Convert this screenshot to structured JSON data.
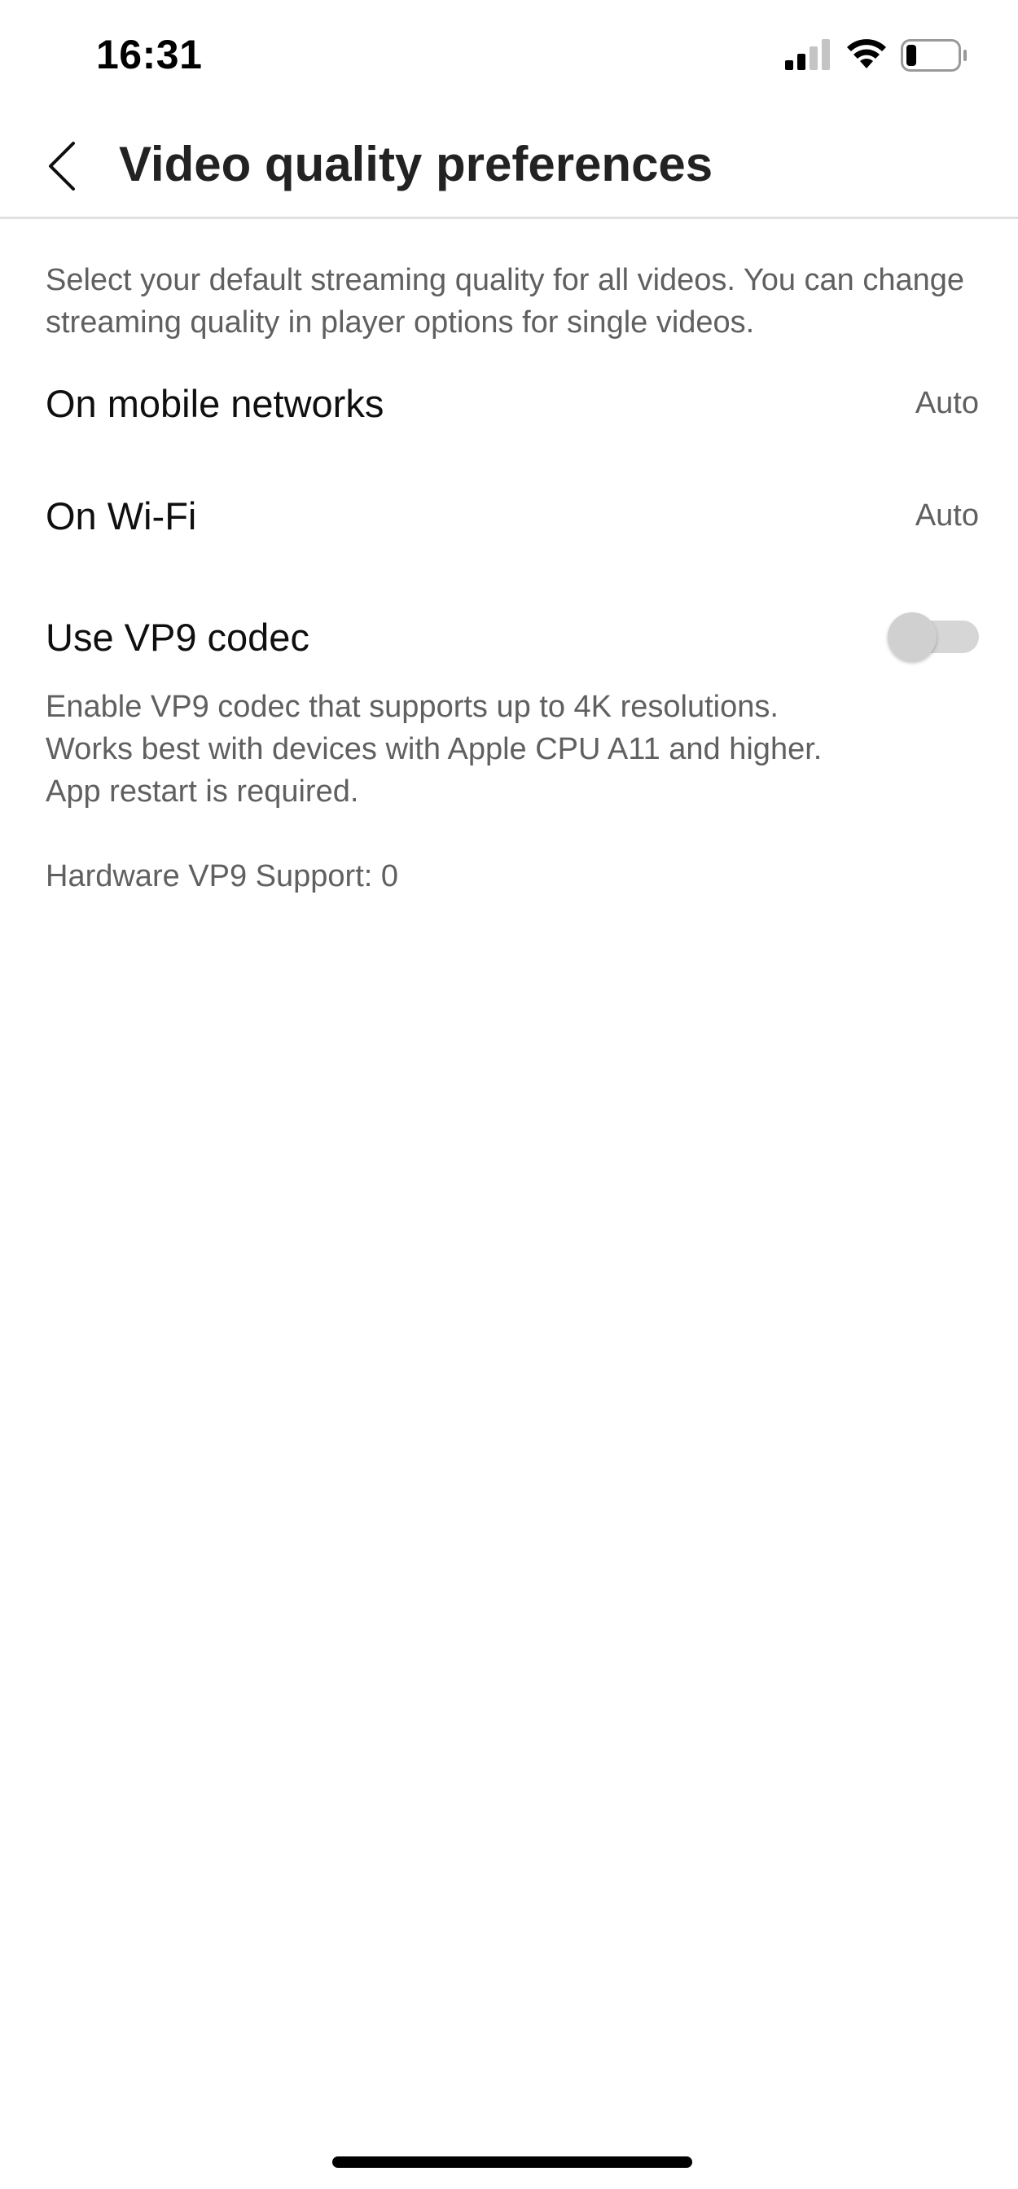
{
  "status_bar": {
    "time": "16:31",
    "signal_icon": "cellular-signal-icon",
    "wifi_icon": "wifi-icon",
    "battery_icon": "battery-low-icon",
    "battery_level": 0.2
  },
  "header": {
    "back_icon": "chevron-left-icon",
    "title": "Video quality preferences"
  },
  "main": {
    "description": "Select your default streaming quality for all videos. You can change streaming quality in player options for single videos.",
    "settings": [
      {
        "label": "On mobile networks",
        "value": "Auto"
      },
      {
        "label": "On Wi-Fi",
        "value": "Auto"
      }
    ],
    "vp9": {
      "label": "Use VP9 codec",
      "enabled": false,
      "description": "Enable VP9 codec that supports up to 4K resolutions. Works best with devices with Apple CPU A11 and higher. App restart is required."
    },
    "hardware_support": "Hardware VP9 Support: 0"
  },
  "colors": {
    "text_primary": "#0f0f0f",
    "text_secondary": "#606060",
    "divider": "#e0e0e0",
    "toggle_off": "#d6d6d6"
  }
}
